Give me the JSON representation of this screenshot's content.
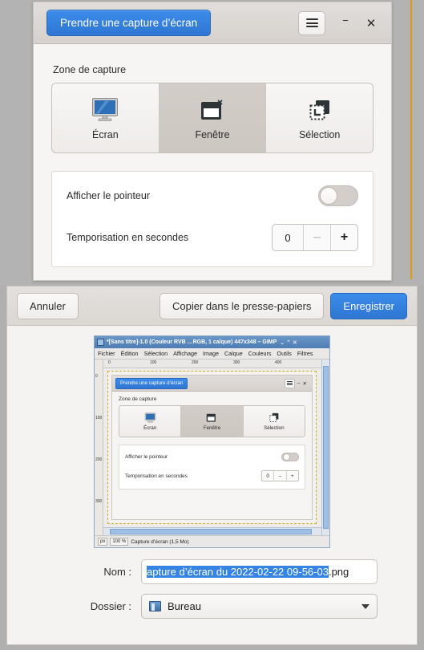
{
  "dialog": {
    "capture_button": "Prendre une capture d’écran",
    "menu_icon": "hamburger-icon",
    "minimize_icon": "−",
    "close_icon": "✕",
    "section_title": "Zone de capture",
    "modes": [
      {
        "label": "Écran",
        "icon": "monitor-icon",
        "selected": false
      },
      {
        "label": "Fenêtre",
        "icon": "window-icon",
        "selected": true
      },
      {
        "label": "Sélection",
        "icon": "selection-icon",
        "selected": false
      }
    ],
    "options": {
      "pointer_label": "Afficher le pointeur",
      "pointer_state": "off",
      "delay_label": "Temporisation en secondes",
      "delay_value": "0",
      "decrement": "–",
      "increment": "+"
    }
  },
  "sheet": {
    "cancel_label": "Annuler",
    "copy_label": "Copier dans le presse-papiers",
    "save_label": "Enregistrer"
  },
  "preview": {
    "title": "*[Sans titre]-1.0 (Couleur RVB …RGB, 1 calque) 447x348 – GIMP",
    "window_buttons": "⌄  ⌃  ✕",
    "menus": [
      "Fichier",
      "Édition",
      "Sélection",
      "Affichage",
      "Image",
      "Calque",
      "Couleurs",
      "Outils",
      "Filtres"
    ],
    "ruler_h_ticks": [
      "0",
      "100",
      "200",
      "300",
      "400"
    ],
    "ruler_v_ticks": [
      "0",
      "100",
      "200",
      "300"
    ],
    "status": {
      "unit": "px",
      "zoom": "100 %",
      "text": "Capture d’écran (1,5 Mo)"
    },
    "inner": {
      "capture_button": "Prendre une capture d’écran",
      "section_title": "Zone de capture",
      "modes": [
        {
          "label": "Écran",
          "selected": false
        },
        {
          "label": "Fenêtre",
          "selected": true
        },
        {
          "label": "Sélection",
          "selected": false
        }
      ],
      "pointer_label": "Afficher le pointeur",
      "delay_label": "Temporisation en secondes",
      "delay_value": "0",
      "decrement": "–",
      "increment": "+"
    }
  },
  "form": {
    "name_label": "Nom :",
    "name_selected": "apture d’écran du 2022-02-22 09-56-03",
    "name_suffix": ".png",
    "folder_label": "Dossier :",
    "folder_value": "Bureau",
    "folder_icon": "desktop-folder-icon",
    "chevron_icon": "chevron-down-icon"
  },
  "colors": {
    "accent_blue": "#3584e4",
    "selection_blue": "#3584e4",
    "header_grey": "#dcd8d4",
    "desktop_grey": "#b3b3b3",
    "gold_line": "#d79c12"
  }
}
